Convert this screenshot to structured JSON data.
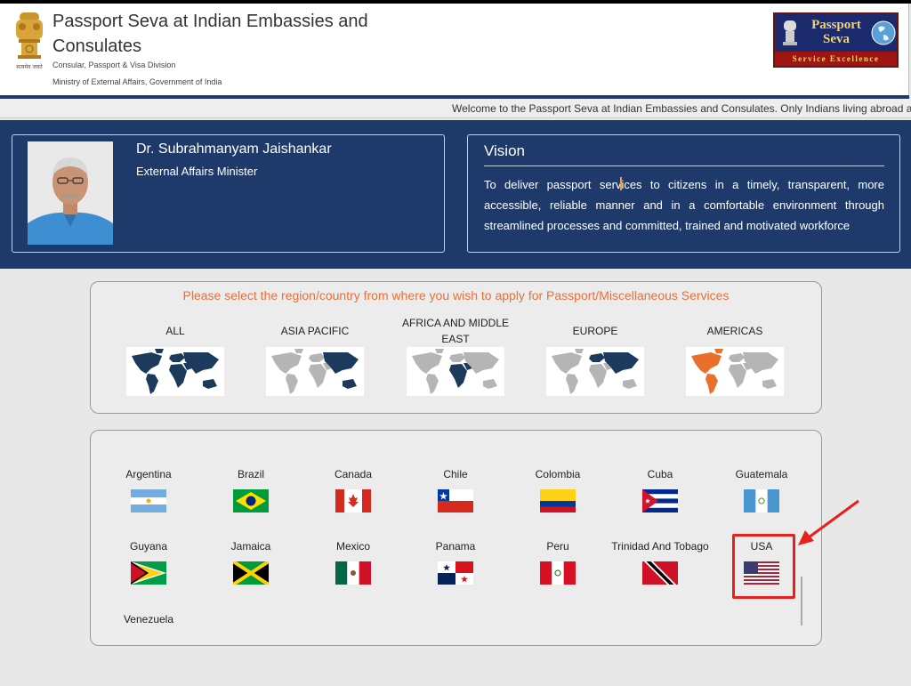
{
  "header": {
    "title": "Passport Seva at Indian Embassies and Consulates",
    "division": "Consular, Passport & Visa Division",
    "ministry": "Ministry of External Affairs, Government of India",
    "emblem_motto": "सत्यमेव जयते",
    "logo_line1": "Passport",
    "logo_line2": "Seva",
    "logo_tagline": "Service Excellence"
  },
  "ticker": {
    "text": "Welcome to the Passport Seva at Indian Embassies and Consulates. Only Indians living abroad are eli"
  },
  "minister": {
    "name": "Dr. Subrahmanyam Jaishankar",
    "title": "External Affairs Minister"
  },
  "vision": {
    "title": "Vision",
    "text_a": "To deliver passport serv",
    "text_b": "ices to citizens in a timely, transparent, more accessible, reliable manner and in a comfortable environment through streamlined processes and committed, trained and motivated workforce"
  },
  "regions": {
    "prompt": "Please select the region/country from where you wish to apply for Passport/Miscellaneous Services",
    "items": [
      {
        "label": "ALL",
        "map": "world-all-highlighted"
      },
      {
        "label": "ASIA PACIFIC",
        "map": "world-asia-pacific-highlighted"
      },
      {
        "label": "AFRICA AND MIDDLE EAST",
        "map": "world-africa-middle-east-highlighted"
      },
      {
        "label": "EUROPE",
        "map": "world-europe-highlighted"
      },
      {
        "label": "AMERICAS",
        "map": "world-americas-highlighted"
      }
    ],
    "selected": "AMERICAS"
  },
  "countries": {
    "items": [
      {
        "label": "Argentina",
        "flag": "argentina-flag"
      },
      {
        "label": "Brazil",
        "flag": "brazil-flag"
      },
      {
        "label": "Canada",
        "flag": "canada-flag"
      },
      {
        "label": "Chile",
        "flag": "chile-flag"
      },
      {
        "label": "Colombia",
        "flag": "colombia-flag"
      },
      {
        "label": "Cuba",
        "flag": "cuba-flag"
      },
      {
        "label": "Guatemala",
        "flag": "guatemala-flag"
      },
      {
        "label": "Guyana",
        "flag": "guyana-flag"
      },
      {
        "label": "Jamaica",
        "flag": "jamaica-flag"
      },
      {
        "label": "Mexico",
        "flag": "mexico-flag"
      },
      {
        "label": "Panama",
        "flag": "panama-flag"
      },
      {
        "label": "Peru",
        "flag": "peru-flag"
      },
      {
        "label": "Trinidad And Tobago",
        "flag": "trinidad-and-tobago-flag"
      },
      {
        "label": "USA",
        "flag": "usa-flag"
      },
      {
        "label": "Venezuela",
        "flag": "venezuela-flag"
      }
    ],
    "highlighted": "USA"
  },
  "colors": {
    "navy": "#1e3a6b",
    "prompt_orange": "#e8703a",
    "annotation_red": "#e8201c",
    "map_highlight_dark": "#1b3a5c",
    "map_highlight_orange": "#e8702a",
    "map_grey": "#b5b5b5"
  }
}
